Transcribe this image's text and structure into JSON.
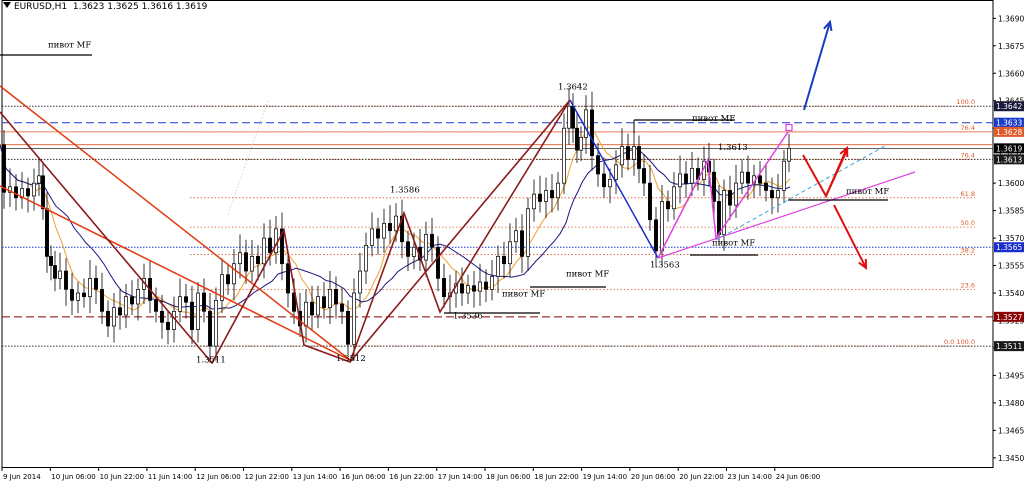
{
  "header": {
    "symbol": "EURUSD,H1",
    "ohlc": "1.3623 1.3625 1.3616 1.3619"
  },
  "chart_data": {
    "type": "candlestick",
    "symbol": "EURUSD",
    "timeframe": "H1",
    "ylim": [
      1.3445,
      1.37
    ],
    "y_ticks": [
      "1.3690",
      "1.3675",
      "1.3660",
      "1.3645",
      "1.3630",
      "1.3615",
      "1.3600",
      "1.3585",
      "1.3570",
      "1.3555",
      "1.3540",
      "1.3525",
      "1.3510",
      "1.3495",
      "1.3480",
      "1.3465",
      "1.3450"
    ],
    "x_ticks": [
      "9 Jun 2014",
      "10 Jun 06:00",
      "10 Jun 22:00",
      "11 Jun 14:00",
      "12 Jun 06:00",
      "12 Jun 22:00",
      "13 Jun 14:00",
      "16 Jun 06:00",
      "16 Jun 22:00",
      "17 Jun 14:00",
      "18 Jun 06:00",
      "18 Jun 22:00",
      "19 Jun 14:00",
      "20 Jun 06:00",
      "20 Jun 22:00",
      "23 Jun 14:00",
      "24 Jun 06:00"
    ],
    "price_path": [
      [
        0,
        1.3621
      ],
      [
        6,
        1.3595
      ],
      [
        12,
        1.3598
      ],
      [
        18,
        1.3592
      ],
      [
        24,
        1.3597
      ],
      [
        30,
        1.3593
      ],
      [
        36,
        1.36
      ],
      [
        40,
        1.3604
      ],
      [
        44,
        1.3586
      ],
      [
        48,
        1.356
      ],
      [
        52,
        1.3555
      ],
      [
        56,
        1.3548
      ],
      [
        62,
        1.3552
      ],
      [
        68,
        1.3542
      ],
      [
        74,
        1.3536
      ],
      [
        80,
        1.354
      ],
      [
        86,
        1.3538
      ],
      [
        92,
        1.3548
      ],
      [
        98,
        1.3542
      ],
      [
        104,
        1.353
      ],
      [
        110,
        1.3522
      ],
      [
        116,
        1.3532
      ],
      [
        122,
        1.3528
      ],
      [
        128,
        1.3538
      ],
      [
        134,
        1.3534
      ],
      [
        140,
        1.3542
      ],
      [
        146,
        1.3548
      ],
      [
        152,
        1.3536
      ],
      [
        158,
        1.353
      ],
      [
        164,
        1.3524
      ],
      [
        170,
        1.352
      ],
      [
        176,
        1.353
      ],
      [
        182,
        1.3538
      ],
      [
        188,
        1.3535
      ],
      [
        194,
        1.352
      ],
      [
        200,
        1.354
      ],
      [
        206,
        1.353
      ],
      [
        212,
        1.3511
      ],
      [
        218,
        1.3536
      ],
      [
        224,
        1.355
      ],
      [
        230,
        1.3545
      ],
      [
        236,
        1.3556
      ],
      [
        242,
        1.3562
      ],
      [
        248,
        1.3552
      ],
      [
        254,
        1.356
      ],
      [
        260,
        1.3556
      ],
      [
        266,
        1.357
      ],
      [
        272,
        1.3562
      ],
      [
        278,
        1.3575
      ],
      [
        284,
        1.3556
      ],
      [
        290,
        1.354
      ],
      [
        296,
        1.353
      ],
      [
        302,
        1.3522
      ],
      [
        308,
        1.3535
      ],
      [
        314,
        1.3528
      ],
      [
        320,
        1.3538
      ],
      [
        326,
        1.3532
      ],
      [
        332,
        1.3542
      ],
      [
        338,
        1.3534
      ],
      [
        344,
        1.353
      ],
      [
        350,
        1.3512
      ],
      [
        356,
        1.354
      ],
      [
        362,
        1.3552
      ],
      [
        368,
        1.3566
      ],
      [
        374,
        1.3575
      ],
      [
        380,
        1.357
      ],
      [
        386,
        1.3578
      ],
      [
        392,
        1.3574
      ],
      [
        398,
        1.3582
      ],
      [
        404,
        1.3568
      ],
      [
        410,
        1.356
      ],
      [
        416,
        1.3565
      ],
      [
        422,
        1.3558
      ],
      [
        428,
        1.3572
      ],
      [
        434,
        1.3565
      ],
      [
        440,
        1.3548
      ],
      [
        446,
        1.3538
      ],
      [
        452,
        1.354
      ],
      [
        458,
        1.3545
      ],
      [
        464,
        1.354
      ],
      [
        470,
        1.3544
      ],
      [
        476,
        1.3541
      ],
      [
        482,
        1.3546
      ],
      [
        488,
        1.3542
      ],
      [
        494,
        1.3549
      ],
      [
        500,
        1.356
      ],
      [
        506,
        1.3556
      ],
      [
        512,
        1.3568
      ],
      [
        518,
        1.3574
      ],
      [
        524,
        1.356
      ],
      [
        530,
        1.3586
      ],
      [
        536,
        1.3594
      ],
      [
        542,
        1.359
      ],
      [
        548,
        1.3596
      ],
      [
        554,
        1.3592
      ],
      [
        560,
        1.36
      ],
      [
        566,
        1.363
      ],
      [
        570,
        1.3642
      ],
      [
        574,
        1.363
      ],
      [
        578,
        1.3618
      ],
      [
        582,
        1.3625
      ],
      [
        588,
        1.364
      ],
      [
        594,
        1.3615
      ],
      [
        600,
        1.3605
      ],
      [
        606,
        1.3598
      ],
      [
        612,
        1.3602
      ],
      [
        618,
        1.361
      ],
      [
        624,
        1.362
      ],
      [
        630,
        1.3613
      ],
      [
        636,
        1.362
      ],
      [
        640,
        1.3608
      ],
      [
        646,
        1.36
      ],
      [
        652,
        1.358
      ],
      [
        658,
        1.3563
      ],
      [
        664,
        1.359
      ],
      [
        670,
        1.3586
      ],
      [
        676,
        1.3598
      ],
      [
        682,
        1.3605
      ],
      [
        688,
        1.36
      ],
      [
        694,
        1.3608
      ],
      [
        700,
        1.3602
      ],
      [
        706,
        1.3612
      ],
      [
        710,
        1.3606
      ],
      [
        716,
        1.359
      ],
      [
        720,
        1.3572
      ],
      [
        726,
        1.3596
      ],
      [
        732,
        1.3588
      ],
      [
        738,
        1.36
      ],
      [
        744,
        1.3606
      ],
      [
        750,
        1.36
      ],
      [
        756,
        1.3604
      ],
      [
        762,
        1.36
      ],
      [
        768,
        1.3596
      ],
      [
        774,
        1.3592
      ],
      [
        780,
        1.3596
      ],
      [
        786,
        1.3612
      ],
      [
        790,
        1.3619
      ]
    ],
    "horizontal_levels": [
      {
        "price": 1.3642,
        "label": "1.3642",
        "color": "#333333",
        "style": "dotted"
      },
      {
        "price": 1.3633,
        "label": "1.3633",
        "color": "#1a3ccc",
        "style": "dashed"
      },
      {
        "price": 1.3619,
        "label": "1.3619",
        "color": "#000000",
        "style": "solid"
      },
      {
        "price": 1.3613,
        "label": "1.3613",
        "color": "#333333",
        "style": "dotted"
      },
      {
        "price": 1.3565,
        "label": "1.3565",
        "color": "#1a3ccc",
        "style": "dotted"
      },
      {
        "price": 1.3527,
        "label": "1.3527",
        "color": "#8b0000",
        "style": "dashed"
      },
      {
        "price": 1.3511,
        "label": "1.3511",
        "color": "#333333",
        "style": "dotted"
      }
    ],
    "fibonacci": {
      "color": "#e05a28",
      "levels": [
        {
          "price": 1.3642,
          "label": "100.0"
        },
        {
          "price": 1.3628,
          "label": "76.4"
        },
        {
          "price": 1.3613,
          "label": "76.4"
        },
        {
          "price": 1.3592,
          "label": "61.8"
        },
        {
          "price": 1.3576,
          "label": "50.0"
        },
        {
          "price": 1.3561,
          "label": "38.2"
        },
        {
          "price": 1.3542,
          "label": "23.6"
        },
        {
          "price": 1.3511,
          "label": "0.0  100.0"
        }
      ]
    },
    "annotations": [
      {
        "text": "пивот MF",
        "x": 48,
        "price": 1.3674
      },
      {
        "text": "1.3642",
        "x": 558,
        "price": 1.3651
      },
      {
        "text": "пивот MF",
        "x": 692,
        "price": 1.3634
      },
      {
        "text": "1.3613",
        "x": 718,
        "price": 1.3618
      },
      {
        "text": "1.3586",
        "x": 390,
        "price": 1.3595
      },
      {
        "text": "пивот MF",
        "x": 566,
        "price": 1.3549
      },
      {
        "text": "пивот MF",
        "x": 502,
        "price": 1.3538
      },
      {
        "text": "1.3536",
        "x": 453,
        "price": 1.3526
      },
      {
        "text": "1.3563",
        "x": 650,
        "price": 1.3554
      },
      {
        "text": "пивот MF",
        "x": 712,
        "price": 1.3566
      },
      {
        "text": "пивот MF",
        "x": 846,
        "price": 1.3594
      },
      {
        "text": "1.3511",
        "x": 196,
        "price": 1.3502
      },
      {
        "text": "1.3512",
        "x": 336,
        "price": 1.3503
      }
    ],
    "colors": {
      "bull_body": "#ffffff",
      "bear_body": "#000000",
      "ma_fast": "#f0a030",
      "ma_slow": "#1a1a80",
      "zigzag": "#8b1a1a",
      "trend_red": "#e03a10",
      "impulse_blue": "#1a2ecc",
      "magenta": "#e040e0",
      "arrow_red": "#e01010",
      "arrow_blue": "#1a3cc0",
      "current_price_box": "#e05a28",
      "level_box_dark": "#1a1a3a"
    }
  }
}
